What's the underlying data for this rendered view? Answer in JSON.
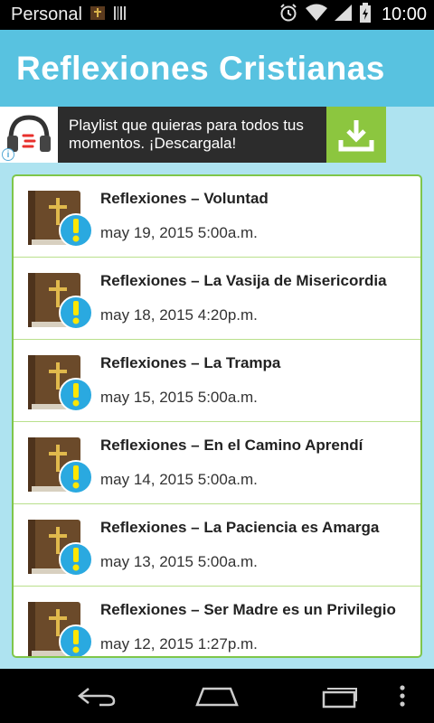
{
  "status_bar": {
    "carrier": "Personal",
    "time": "10:00"
  },
  "header": {
    "title": "Reflexiones Cristianas"
  },
  "ad": {
    "text": "Playlist que quieras para todos tus momentos. ¡Descargala!",
    "info_label": "i"
  },
  "posts": [
    {
      "title": "Reflexiones – Voluntad",
      "date": "may 19, 2015 5:00a.m."
    },
    {
      "title": "Reflexiones – La Vasija de Misericordia",
      "date": "may 18, 2015 4:20p.m."
    },
    {
      "title": "Reflexiones – La Trampa",
      "date": "may 15, 2015 5:00a.m."
    },
    {
      "title": "Reflexiones – En el Camino Aprendí",
      "date": "may 14, 2015 5:00a.m."
    },
    {
      "title": "Reflexiones – La Paciencia es Amarga",
      "date": "may 13, 2015 5:00a.m."
    },
    {
      "title": "Reflexiones – Ser Madre es un Privilegio",
      "date": "may 12, 2015 1:27p.m."
    }
  ],
  "colors": {
    "header_bg": "#58c2e0",
    "app_bg": "#aee3f0",
    "list_border": "#7fc64a",
    "ad_download_bg": "#8cc63f"
  },
  "icons": {
    "post_thumb": "bible-alert-icon",
    "ad_logo": "headphones-icon",
    "ad_action": "download-icon",
    "nav": [
      "back-icon",
      "home-icon",
      "recent-apps-icon",
      "overflow-menu-icon"
    ]
  }
}
